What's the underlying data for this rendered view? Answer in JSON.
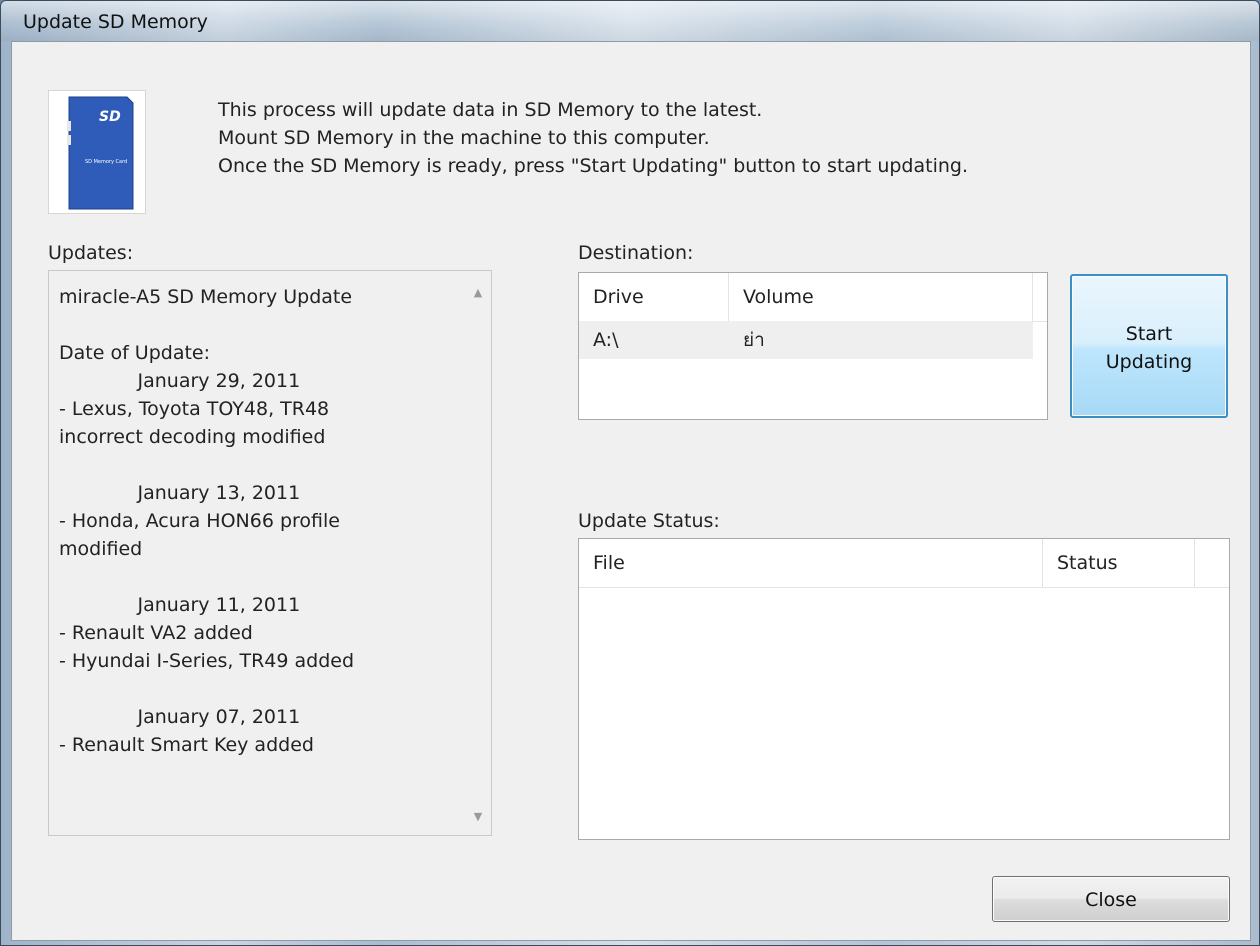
{
  "window": {
    "title": "Update SD Memory"
  },
  "sd_card": {
    "icon": "sd-card-icon",
    "brand": "SD",
    "label": "SD Memory Card"
  },
  "intro": {
    "line1": "This process will update data in SD Memory to the latest.",
    "line2": "Mount SD Memory in the machine to this computer.",
    "line3": "Once the SD Memory is ready, press \"Start Updating\" button to start updating."
  },
  "updates": {
    "label": "Updates:",
    "text": "miracle-A5 SD Memory Update\n\nDate of Update:\n             January 29, 2011\n- Lexus, Toyota TOY48, TR48\nincorrect decoding modified\n\n             January 13, 2011\n- Honda, Acura HON66 profile\nmodified\n\n             January 11, 2011\n- Renault VA2 added\n- Hyundai I-Series, TR49 added\n\n             January 07, 2011\n- Renault Smart Key added"
  },
  "destination": {
    "label": "Destination:",
    "columns": [
      "Drive",
      "Volume"
    ],
    "rows": [
      {
        "drive": "A:\\",
        "volume": "ย่า"
      }
    ]
  },
  "start_button": {
    "line1": "Start",
    "line2": "Updating"
  },
  "update_status": {
    "label": "Update Status:",
    "columns": [
      "File",
      "Status"
    ]
  },
  "close_button": {
    "label": "Close"
  }
}
